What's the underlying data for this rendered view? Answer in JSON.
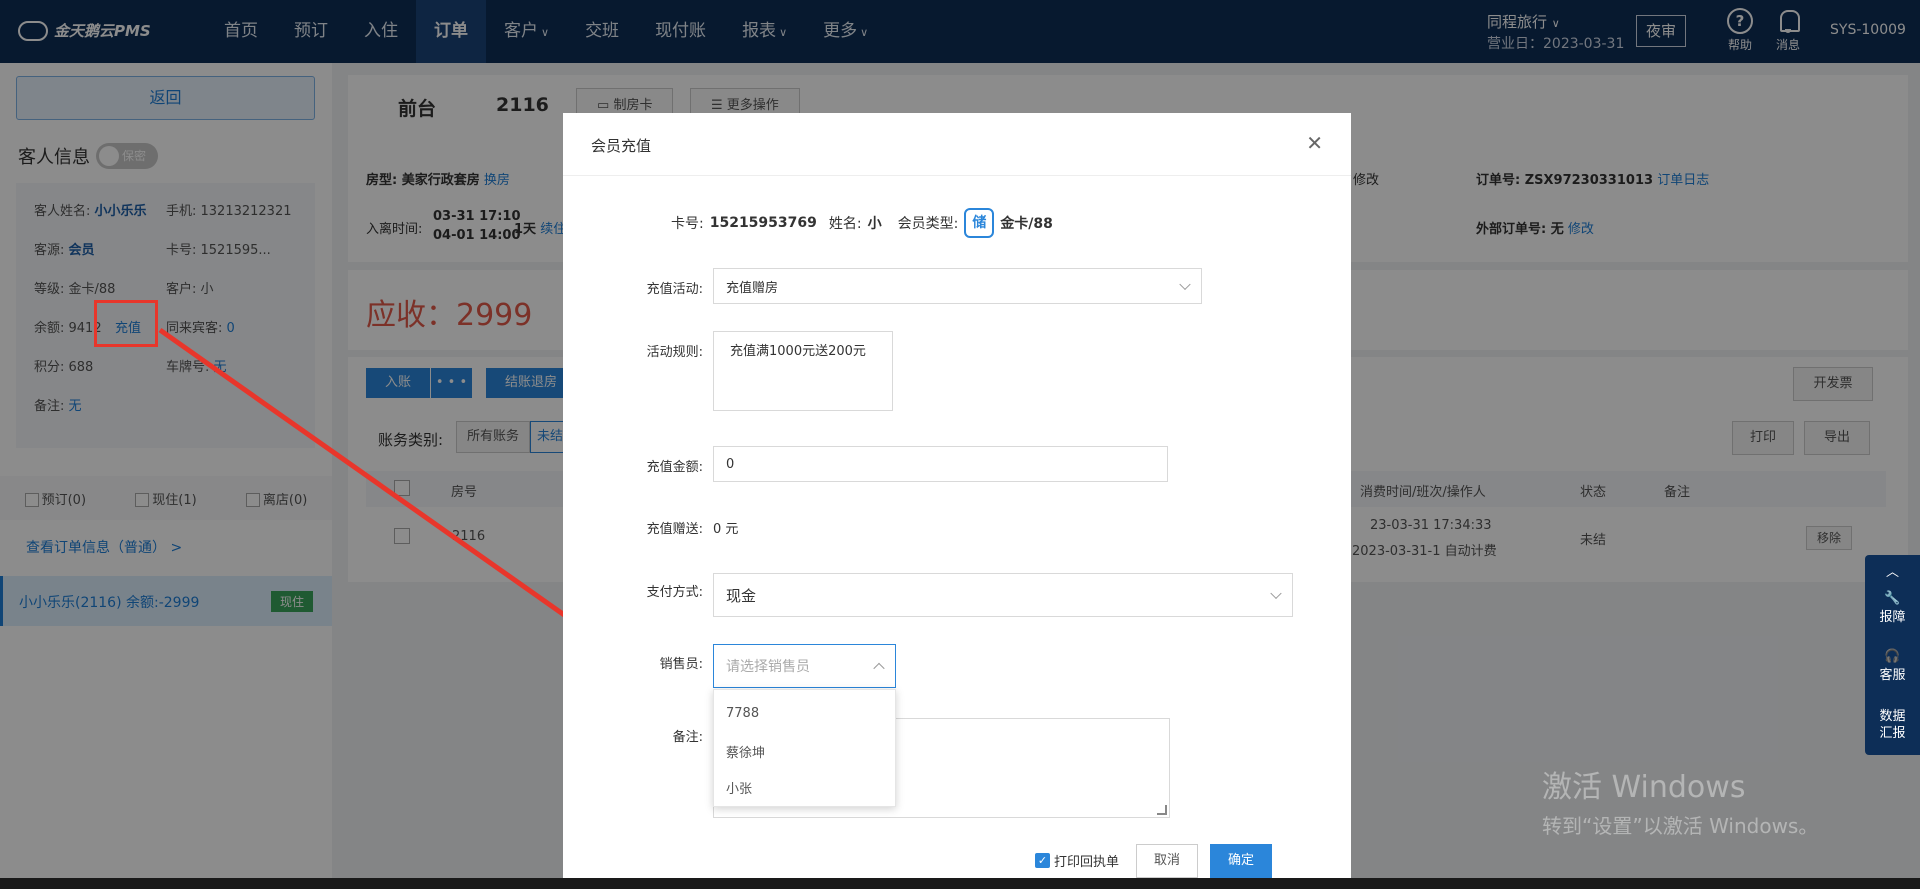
{
  "app": {
    "logo": "金天鹅云PMS",
    "nav": [
      {
        "label": "首页",
        "chevron": false
      },
      {
        "label": "预订",
        "chevron": false
      },
      {
        "label": "入住",
        "chevron": false
      },
      {
        "label": "订单",
        "chevron": false,
        "active": true
      },
      {
        "label": "客户",
        "chevron": true
      },
      {
        "label": "交班",
        "chevron": false
      },
      {
        "label": "现付账",
        "chevron": false
      },
      {
        "label": "报表",
        "chevron": true
      },
      {
        "label": "更多",
        "chevron": true
      }
    ],
    "hotel_name": "同程旅行",
    "business_day": "营业日：2023-03-31",
    "night_audit": "夜审",
    "help": "帮助",
    "messages": "消息",
    "user": "SYS-10009"
  },
  "left": {
    "return": "返回",
    "guest_title": "客人信息",
    "privacy": "保密",
    "name_label": "客人姓名:",
    "name": "小小乐乐",
    "phone": "手机: 13213212321",
    "source_label": "客源:",
    "source": "会员",
    "card": "卡号: 1521595...",
    "level": "等级: 金卡/88",
    "customer": "客户: 小",
    "balance": "余额: 9412",
    "recharge": "充值",
    "companions_label": "同来宾客:",
    "companions": "0",
    "points": "积分: 688",
    "plate_label": "车牌号:",
    "plate": "无",
    "remark_label": "备注:",
    "remark": "无",
    "statuses": [
      "预订(0)",
      "现住(1)",
      "离店(0)"
    ],
    "order_link": "查看订单信息（普通） >",
    "guest_item": "小小乐乐(2116)   余额:-2999",
    "guest_tag": "现住"
  },
  "main": {
    "front": "前台",
    "room": "2116",
    "make_card": "制房卡",
    "more_ops": "更多操作",
    "room_type": "房型: 美家行政套房",
    "change_room": "换房",
    "checkin_label": "入离时间:",
    "checkin_in": "03-31 17:10",
    "checkin_out": "04-01 14:00",
    "nights": "1天",
    "extend": "续住",
    "modify": "修改",
    "order_no": "订单号: ZSX97230331013",
    "order_log": "订单日志",
    "external_order": "外部订单号: 无",
    "external_modify": "修改",
    "due": "应收：2999",
    "entry": "入账",
    "more_dots": "• • •",
    "checkout": "结账退房",
    "invoice": "开发票",
    "account_type": "账务类别:",
    "all_accounts": "所有账务",
    "unsettled": "未结",
    "print": "打印",
    "export": "导出",
    "col_room": "房号",
    "col_time": "消费时间/班次/操作人",
    "col_status": "状态",
    "col_remark": "备注",
    "row_room": "2116",
    "row_time1": "23-03-31 17:34:33",
    "row_time2": "2023-03-31-1 自动计费",
    "row_status": "未结",
    "row_remove": "移除"
  },
  "modal": {
    "title": "会员充值",
    "card_label": "卡号:",
    "card_no": "15215953769",
    "name_label": "姓名:",
    "name": "小",
    "type_label": "会员类型:",
    "type_badge": "储",
    "type_value": "金卡/88",
    "activity_label": "充值活动:",
    "activity_value": "充值赠房",
    "rule_label": "活动规则:",
    "rule_value": "充值满1000元送200元",
    "amount_label": "充值金额:",
    "amount_value": "0",
    "gift_label": "充值赠送:",
    "gift_value": "0 元",
    "pay_label": "支付方式:",
    "pay_value": "现金",
    "sales_label": "销售员:",
    "sales_placeholder": "请选择销售员",
    "sales_options": [
      "7788",
      "蔡徐坤",
      "小张"
    ],
    "note_label": "备注:",
    "print_receipt": "打印回执单",
    "cancel": "取消",
    "confirm": "确定"
  },
  "float": {
    "report": "报障",
    "service": "客服",
    "data1": "数据",
    "data2": "汇报"
  },
  "watermark": {
    "line1": "激活 Windows",
    "line2": "转到“设置”以激活 Windows。"
  },
  "colors": {
    "nav_bg": "#0d2e57",
    "accent": "#2b86da",
    "due_red": "#e25a4a",
    "annotation_red": "#e8362b"
  }
}
